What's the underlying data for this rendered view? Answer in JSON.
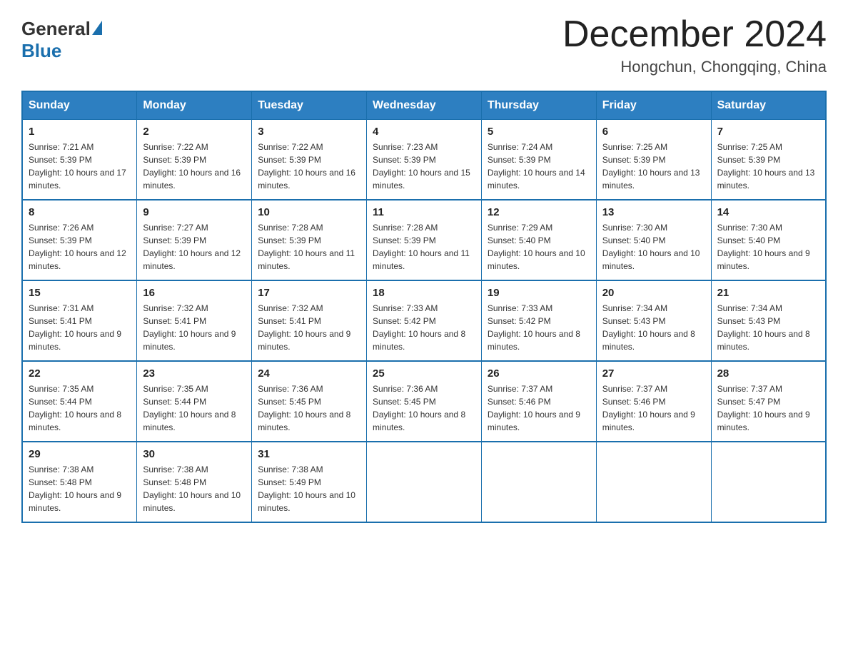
{
  "header": {
    "logo": {
      "general": "General",
      "blue": "Blue"
    },
    "title": "December 2024",
    "location": "Hongchun, Chongqing, China"
  },
  "calendar": {
    "days_of_week": [
      "Sunday",
      "Monday",
      "Tuesday",
      "Wednesday",
      "Thursday",
      "Friday",
      "Saturday"
    ],
    "weeks": [
      [
        {
          "day": "1",
          "sunrise": "Sunrise: 7:21 AM",
          "sunset": "Sunset: 5:39 PM",
          "daylight": "Daylight: 10 hours and 17 minutes."
        },
        {
          "day": "2",
          "sunrise": "Sunrise: 7:22 AM",
          "sunset": "Sunset: 5:39 PM",
          "daylight": "Daylight: 10 hours and 16 minutes."
        },
        {
          "day": "3",
          "sunrise": "Sunrise: 7:22 AM",
          "sunset": "Sunset: 5:39 PM",
          "daylight": "Daylight: 10 hours and 16 minutes."
        },
        {
          "day": "4",
          "sunrise": "Sunrise: 7:23 AM",
          "sunset": "Sunset: 5:39 PM",
          "daylight": "Daylight: 10 hours and 15 minutes."
        },
        {
          "day": "5",
          "sunrise": "Sunrise: 7:24 AM",
          "sunset": "Sunset: 5:39 PM",
          "daylight": "Daylight: 10 hours and 14 minutes."
        },
        {
          "day": "6",
          "sunrise": "Sunrise: 7:25 AM",
          "sunset": "Sunset: 5:39 PM",
          "daylight": "Daylight: 10 hours and 13 minutes."
        },
        {
          "day": "7",
          "sunrise": "Sunrise: 7:25 AM",
          "sunset": "Sunset: 5:39 PM",
          "daylight": "Daylight: 10 hours and 13 minutes."
        }
      ],
      [
        {
          "day": "8",
          "sunrise": "Sunrise: 7:26 AM",
          "sunset": "Sunset: 5:39 PM",
          "daylight": "Daylight: 10 hours and 12 minutes."
        },
        {
          "day": "9",
          "sunrise": "Sunrise: 7:27 AM",
          "sunset": "Sunset: 5:39 PM",
          "daylight": "Daylight: 10 hours and 12 minutes."
        },
        {
          "day": "10",
          "sunrise": "Sunrise: 7:28 AM",
          "sunset": "Sunset: 5:39 PM",
          "daylight": "Daylight: 10 hours and 11 minutes."
        },
        {
          "day": "11",
          "sunrise": "Sunrise: 7:28 AM",
          "sunset": "Sunset: 5:39 PM",
          "daylight": "Daylight: 10 hours and 11 minutes."
        },
        {
          "day": "12",
          "sunrise": "Sunrise: 7:29 AM",
          "sunset": "Sunset: 5:40 PM",
          "daylight": "Daylight: 10 hours and 10 minutes."
        },
        {
          "day": "13",
          "sunrise": "Sunrise: 7:30 AM",
          "sunset": "Sunset: 5:40 PM",
          "daylight": "Daylight: 10 hours and 10 minutes."
        },
        {
          "day": "14",
          "sunrise": "Sunrise: 7:30 AM",
          "sunset": "Sunset: 5:40 PM",
          "daylight": "Daylight: 10 hours and 9 minutes."
        }
      ],
      [
        {
          "day": "15",
          "sunrise": "Sunrise: 7:31 AM",
          "sunset": "Sunset: 5:41 PM",
          "daylight": "Daylight: 10 hours and 9 minutes."
        },
        {
          "day": "16",
          "sunrise": "Sunrise: 7:32 AM",
          "sunset": "Sunset: 5:41 PM",
          "daylight": "Daylight: 10 hours and 9 minutes."
        },
        {
          "day": "17",
          "sunrise": "Sunrise: 7:32 AM",
          "sunset": "Sunset: 5:41 PM",
          "daylight": "Daylight: 10 hours and 9 minutes."
        },
        {
          "day": "18",
          "sunrise": "Sunrise: 7:33 AM",
          "sunset": "Sunset: 5:42 PM",
          "daylight": "Daylight: 10 hours and 8 minutes."
        },
        {
          "day": "19",
          "sunrise": "Sunrise: 7:33 AM",
          "sunset": "Sunset: 5:42 PM",
          "daylight": "Daylight: 10 hours and 8 minutes."
        },
        {
          "day": "20",
          "sunrise": "Sunrise: 7:34 AM",
          "sunset": "Sunset: 5:43 PM",
          "daylight": "Daylight: 10 hours and 8 minutes."
        },
        {
          "day": "21",
          "sunrise": "Sunrise: 7:34 AM",
          "sunset": "Sunset: 5:43 PM",
          "daylight": "Daylight: 10 hours and 8 minutes."
        }
      ],
      [
        {
          "day": "22",
          "sunrise": "Sunrise: 7:35 AM",
          "sunset": "Sunset: 5:44 PM",
          "daylight": "Daylight: 10 hours and 8 minutes."
        },
        {
          "day": "23",
          "sunrise": "Sunrise: 7:35 AM",
          "sunset": "Sunset: 5:44 PM",
          "daylight": "Daylight: 10 hours and 8 minutes."
        },
        {
          "day": "24",
          "sunrise": "Sunrise: 7:36 AM",
          "sunset": "Sunset: 5:45 PM",
          "daylight": "Daylight: 10 hours and 8 minutes."
        },
        {
          "day": "25",
          "sunrise": "Sunrise: 7:36 AM",
          "sunset": "Sunset: 5:45 PM",
          "daylight": "Daylight: 10 hours and 8 minutes."
        },
        {
          "day": "26",
          "sunrise": "Sunrise: 7:37 AM",
          "sunset": "Sunset: 5:46 PM",
          "daylight": "Daylight: 10 hours and 9 minutes."
        },
        {
          "day": "27",
          "sunrise": "Sunrise: 7:37 AM",
          "sunset": "Sunset: 5:46 PM",
          "daylight": "Daylight: 10 hours and 9 minutes."
        },
        {
          "day": "28",
          "sunrise": "Sunrise: 7:37 AM",
          "sunset": "Sunset: 5:47 PM",
          "daylight": "Daylight: 10 hours and 9 minutes."
        }
      ],
      [
        {
          "day": "29",
          "sunrise": "Sunrise: 7:38 AM",
          "sunset": "Sunset: 5:48 PM",
          "daylight": "Daylight: 10 hours and 9 minutes."
        },
        {
          "day": "30",
          "sunrise": "Sunrise: 7:38 AM",
          "sunset": "Sunset: 5:48 PM",
          "daylight": "Daylight: 10 hours and 10 minutes."
        },
        {
          "day": "31",
          "sunrise": "Sunrise: 7:38 AM",
          "sunset": "Sunset: 5:49 PM",
          "daylight": "Daylight: 10 hours and 10 minutes."
        },
        null,
        null,
        null,
        null
      ]
    ]
  }
}
